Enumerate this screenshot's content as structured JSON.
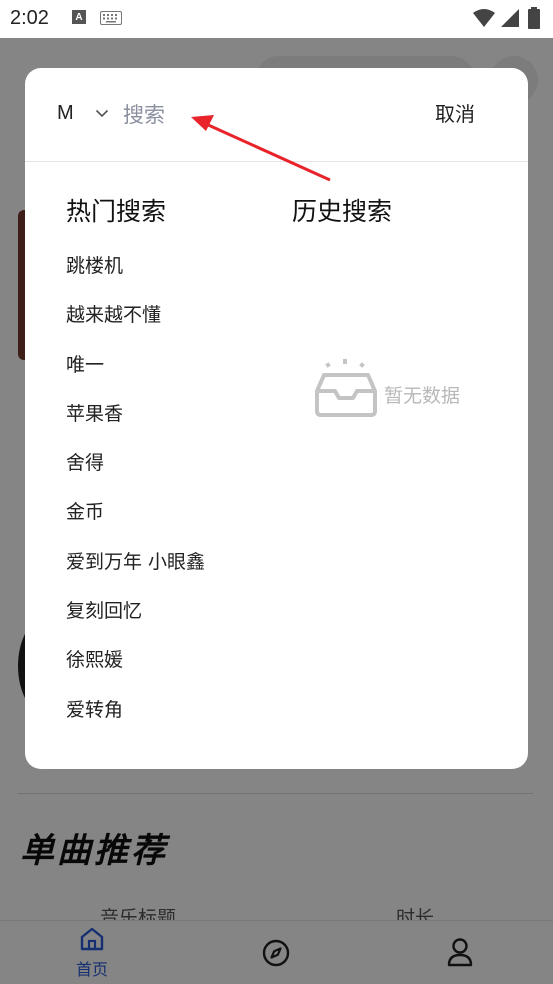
{
  "status_bar": {
    "time": "2:02",
    "a_badge": "A",
    "icons": [
      "keyboard-icon",
      "wifi-icon",
      "signal-icon",
      "battery-icon"
    ]
  },
  "background": {
    "section_title": "单曲推荐",
    "columns": {
      "title": "音乐标题",
      "duration": "时长"
    }
  },
  "bottom_nav": {
    "items": [
      {
        "icon": "home-icon",
        "label": "首页",
        "active": true
      },
      {
        "icon": "compass-icon",
        "label": ""
      },
      {
        "icon": "user-icon",
        "label": ""
      }
    ],
    "active_color": "#2a5bd7"
  },
  "search": {
    "prefix": "M",
    "value": "",
    "placeholder": "搜索",
    "cancel_label": "取消"
  },
  "hot_search": {
    "title": "热门搜索",
    "items": [
      "跳楼机",
      "越来越不懂",
      "唯一",
      "苹果香",
      "舍得",
      "金币",
      "爱到万年 小眼鑫",
      "复刻回忆",
      "徐熙媛",
      "爱转角"
    ]
  },
  "history_search": {
    "title": "历史搜索",
    "empty_text": "暂无数据"
  },
  "colors": {
    "overlay": "rgba(0,0,0,0.48)",
    "annotation": "#e8232a",
    "placeholder": "#8a8fa0",
    "empty_text": "#b8b8b8"
  }
}
